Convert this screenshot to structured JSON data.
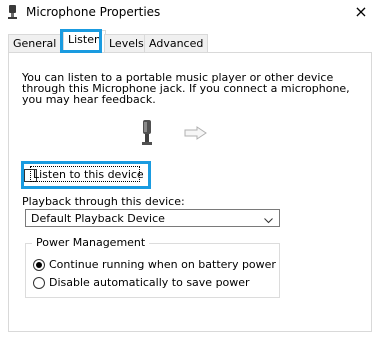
{
  "window": {
    "title": "Microphone Properties",
    "close_glyph": "×"
  },
  "tabs": [
    {
      "label": "General",
      "active": false
    },
    {
      "label": "Listen",
      "active": true
    },
    {
      "label": "Levels",
      "active": false
    },
    {
      "label": "Advanced",
      "active": false
    }
  ],
  "listen": {
    "description": "You can listen to a portable music player or other device through this Microphone jack.  If you connect a microphone, you may hear feedback.",
    "listen_checkbox": {
      "label": "Listen to this device",
      "checked": false
    },
    "playback_label": "Playback through this device:",
    "playback_device": "Default Playback Device",
    "power_management": {
      "label": "Power Management",
      "options": [
        {
          "label": "Continue running when on battery power",
          "selected": true
        },
        {
          "label": "Disable automatically to save power",
          "selected": false
        }
      ]
    }
  },
  "colors": {
    "highlight": "#1a9be0"
  },
  "icons": [
    "microphone-icon",
    "arrow-right-icon",
    "chevron-down-icon",
    "close-icon"
  ]
}
